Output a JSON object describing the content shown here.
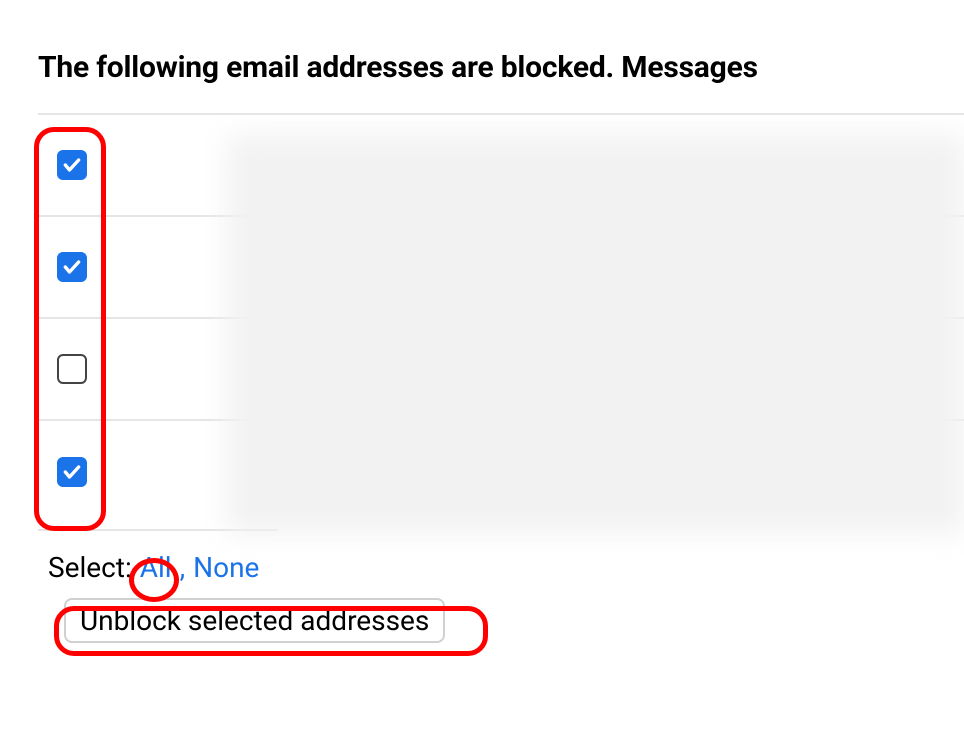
{
  "heading": "The following email addresses are blocked. Messages",
  "rows": [
    {
      "checked": true
    },
    {
      "checked": true
    },
    {
      "checked": false
    },
    {
      "checked": true
    }
  ],
  "select": {
    "label": "Select:",
    "all": "All",
    "separator": ",",
    "none": "None"
  },
  "unblock_button": "Unblock selected addresses"
}
